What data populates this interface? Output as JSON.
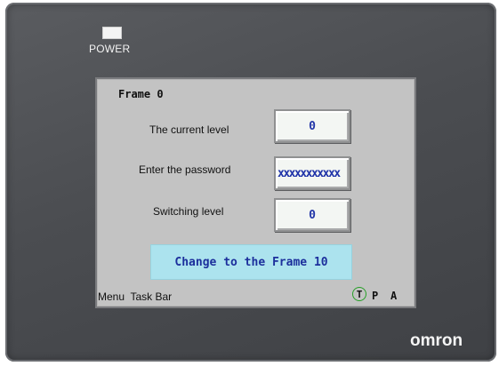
{
  "device": {
    "power_label": "POWER",
    "brand": "omron"
  },
  "screen": {
    "frame_title": "Frame 0",
    "rows": [
      {
        "label": "The current level",
        "value": "0"
      },
      {
        "label": "Enter the password",
        "value": "xxxxxxxxxxx"
      },
      {
        "label": "Switching level",
        "value": "0"
      }
    ],
    "switch_button_label": "Change to the Frame 10",
    "taskbar_label": "Menu  Task Bar",
    "modes": [
      "T",
      "P",
      "A"
    ]
  },
  "colors": {
    "bezel": "#4b4d51",
    "screen": "#c3c3c3",
    "field_background": "#f3f6f3",
    "value_text": "#2236a8",
    "button_background": "#ace3ee",
    "mode_t_ring": "#27a027"
  }
}
